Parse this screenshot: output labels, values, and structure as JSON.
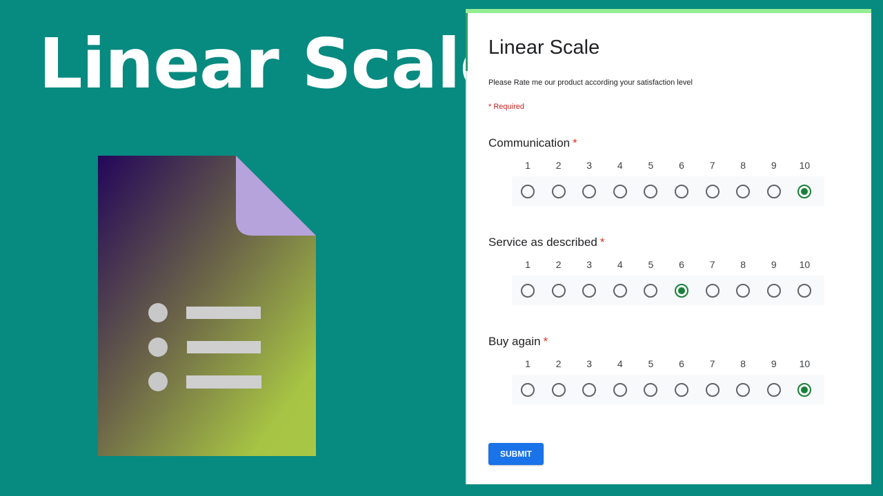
{
  "banner": {
    "title": "Linear Scale",
    "icon": "google-forms-icon"
  },
  "colors": {
    "background": "#078a80",
    "accent_top": "#94ee94",
    "selected_radio": "#188038",
    "required": "#c5221f",
    "submit": "#1a73e8",
    "icon_gradient_start": "#23065a",
    "icon_gradient_end": "#aac844",
    "icon_fold": "#b7a3dc",
    "icon_glyph": "#c8c8c8"
  },
  "form": {
    "title": "Linear Scale",
    "description": "Please Rate me our product according your satisfaction level",
    "required_note": "* Required",
    "questions": [
      {
        "label": "Communication",
        "required_mark": "*",
        "scale": [
          "1",
          "2",
          "3",
          "4",
          "5",
          "6",
          "7",
          "8",
          "9",
          "10"
        ],
        "selected": 10
      },
      {
        "label": "Service as described",
        "required_mark": "*",
        "scale": [
          "1",
          "2",
          "3",
          "4",
          "5",
          "6",
          "7",
          "8",
          "9",
          "10"
        ],
        "selected": 6
      },
      {
        "label": "Buy again",
        "required_mark": "*",
        "scale": [
          "1",
          "2",
          "3",
          "4",
          "5",
          "6",
          "7",
          "8",
          "9",
          "10"
        ],
        "selected": 10
      }
    ],
    "submit_label": "SUBMIT"
  }
}
